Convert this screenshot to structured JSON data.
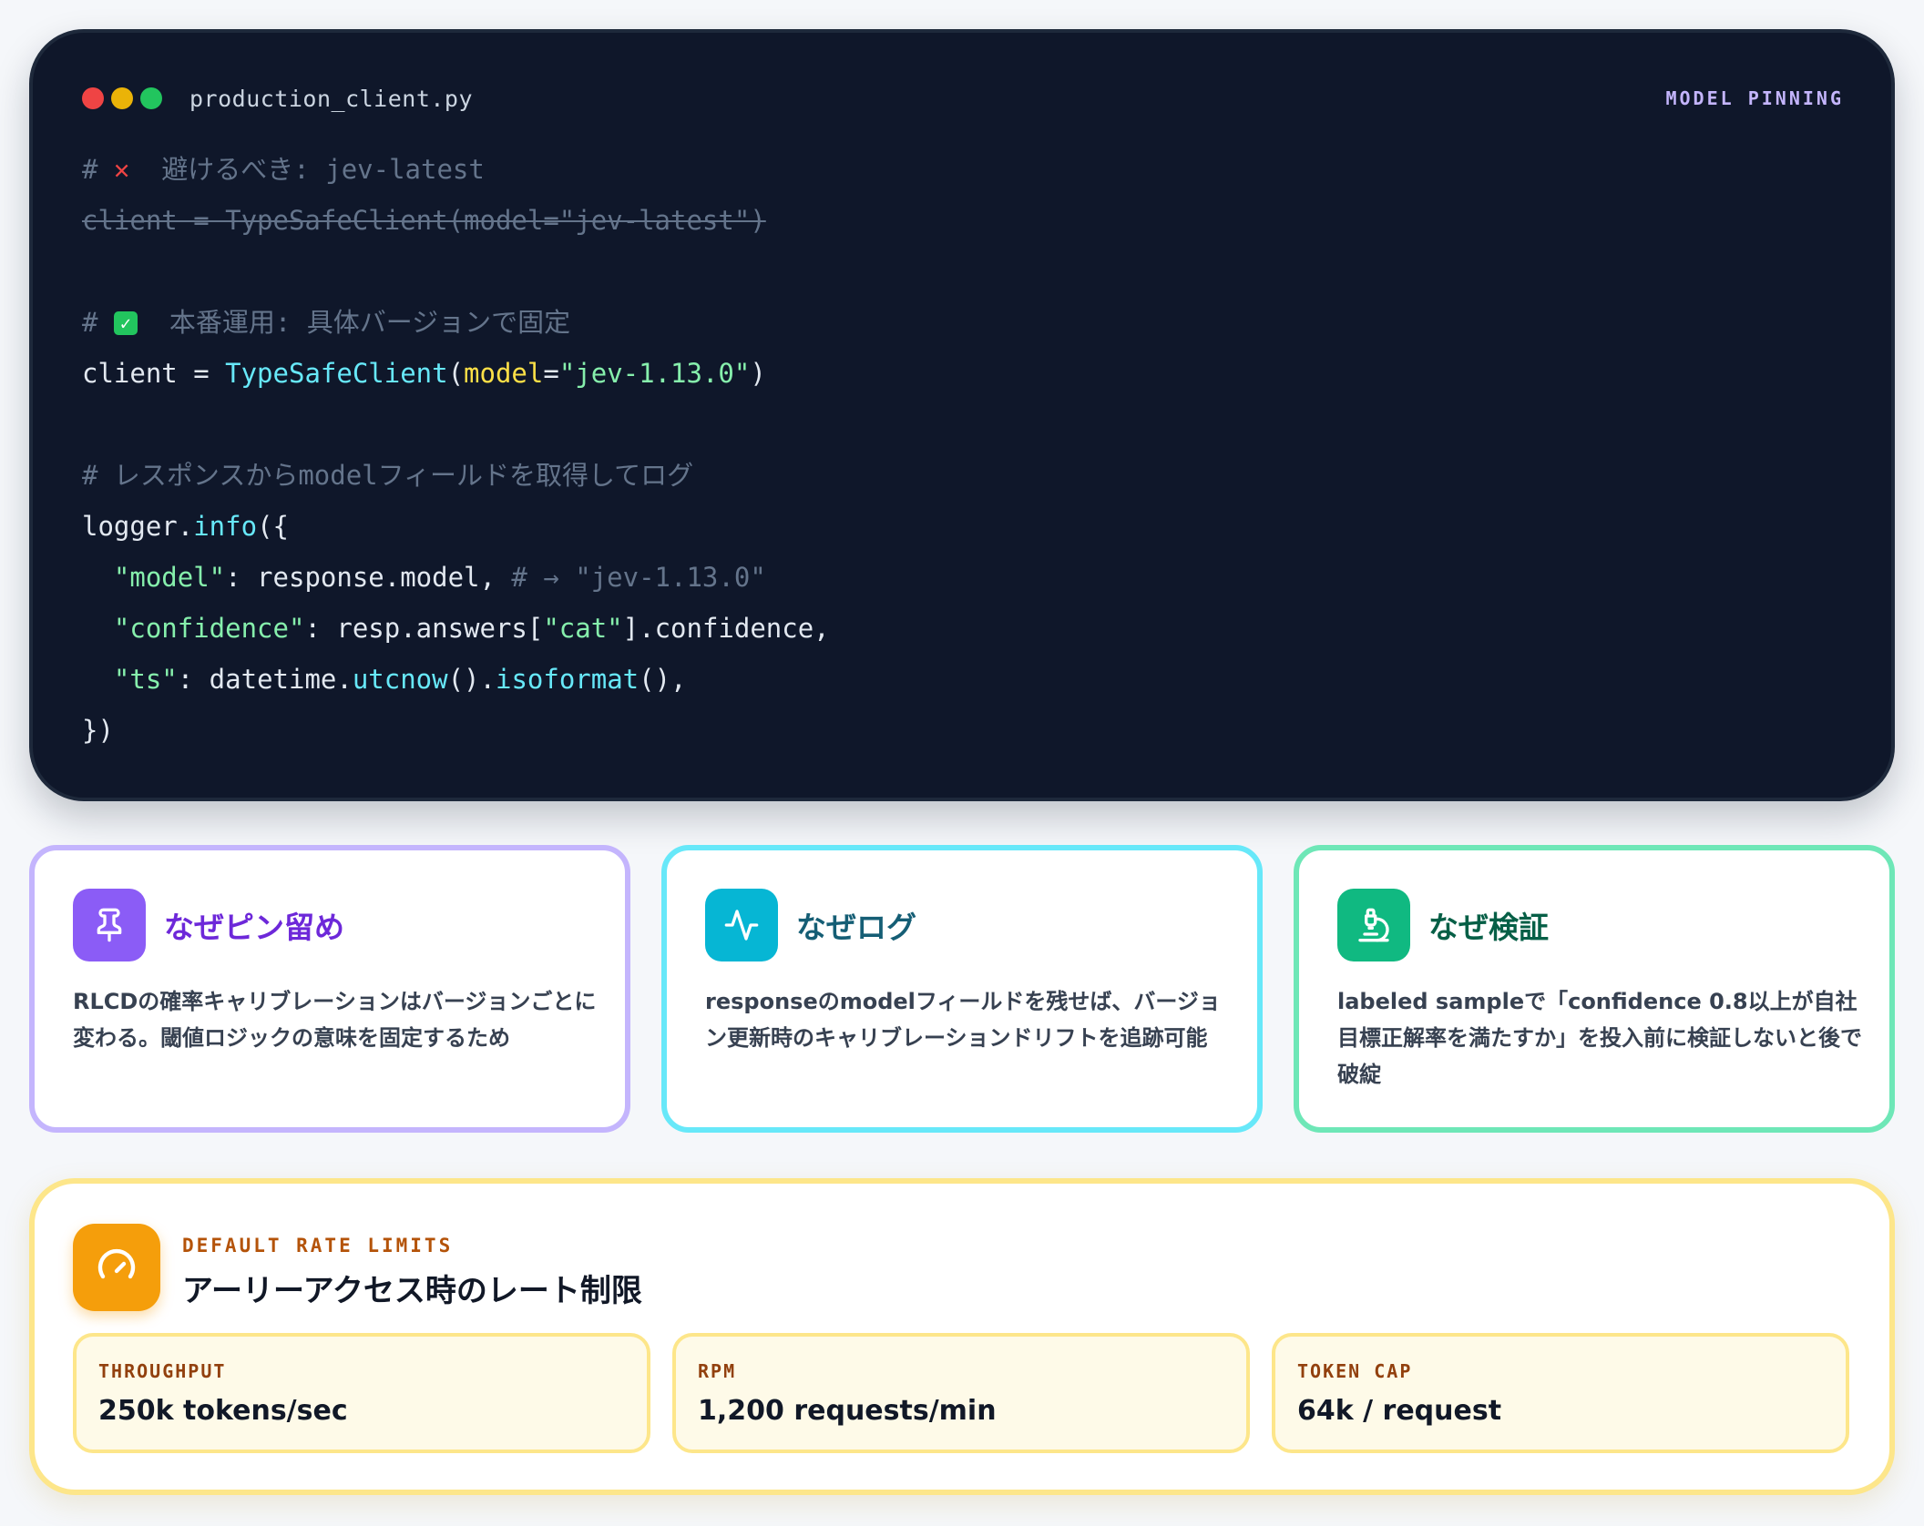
{
  "code_panel": {
    "filename": "production_client.py",
    "badge": "MODEL PINNING",
    "window_dot_colors": [
      "#ef4444",
      "#eab308",
      "#22c55e"
    ],
    "lines": {
      "l1_comment_prefix": "# ",
      "l1_mark": "✕",
      "l1_text": "  避けるべき: jev-latest",
      "l2": "client = TypeSafeClient(model=\"jev-latest\")",
      "l4_comment_prefix": "# ",
      "l4_mark": "✓",
      "l4_text": "  本番運用: 具体バージョンで固定",
      "l5_a": "client = ",
      "l5_fn": "TypeSafeClient",
      "l5_b": "(",
      "l5_kw": "model",
      "l5_c": "=",
      "l5_str": "\"jev-1.13.0\"",
      "l5_d": ")",
      "l7": "# レスポンスからmodelフィールドを取得してログ",
      "l8_a": "logger.",
      "l8_fn": "info",
      "l8_b": "({",
      "l9_indent": "  ",
      "l9_str": "\"model\"",
      "l9_a": ": response.model, ",
      "l9_cmt": "# → \"jev-1.13.0\"",
      "l10_indent": "  ",
      "l10_str1": "\"confidence\"",
      "l10_a": ": resp.answers[",
      "l10_str2": "\"cat\"",
      "l10_b": "].confidence,",
      "l11_indent": "  ",
      "l11_str": "\"ts\"",
      "l11_a": ": datetime.",
      "l11_fn1": "utcnow",
      "l11_b": "().",
      "l11_fn2": "isoformat",
      "l11_c": "(),",
      "l12": "})"
    }
  },
  "reasons": [
    {
      "icon": "pin-icon",
      "title": "なぜピン留め",
      "body": "RLCDの確率キャリブレーションはバージョンごとに変わる。閾値ロジックの意味を固定するため",
      "accent": "#a78bfa",
      "title_color": "#6d28d9"
    },
    {
      "icon": "activity-icon",
      "title": "なぜログ",
      "body": "responseのmodelフィールドを残せば、バージョン更新時のキャリブレーションドリフトを追跡可能",
      "accent": "#06b6d4",
      "title_color": "#155e75"
    },
    {
      "icon": "microscope-icon",
      "title": "なぜ検証",
      "body": "labeled sampleで「confidence 0.8以上が自社目標正解率を満たすか」を投入前に検証しないと後で破綻",
      "accent": "#10b981",
      "title_color": "#065f46"
    }
  ],
  "rate_limits": {
    "icon": "gauge-icon",
    "eyebrow": "DEFAULT RATE LIMITS",
    "title": "アーリーアクセス時のレート制限",
    "items": [
      {
        "label": "THROUGHPUT",
        "value": "250k tokens/sec"
      },
      {
        "label": "RPM",
        "value": "1,200 requests/min"
      },
      {
        "label": "TOKEN CAP",
        "value": "64k / request"
      }
    ]
  }
}
